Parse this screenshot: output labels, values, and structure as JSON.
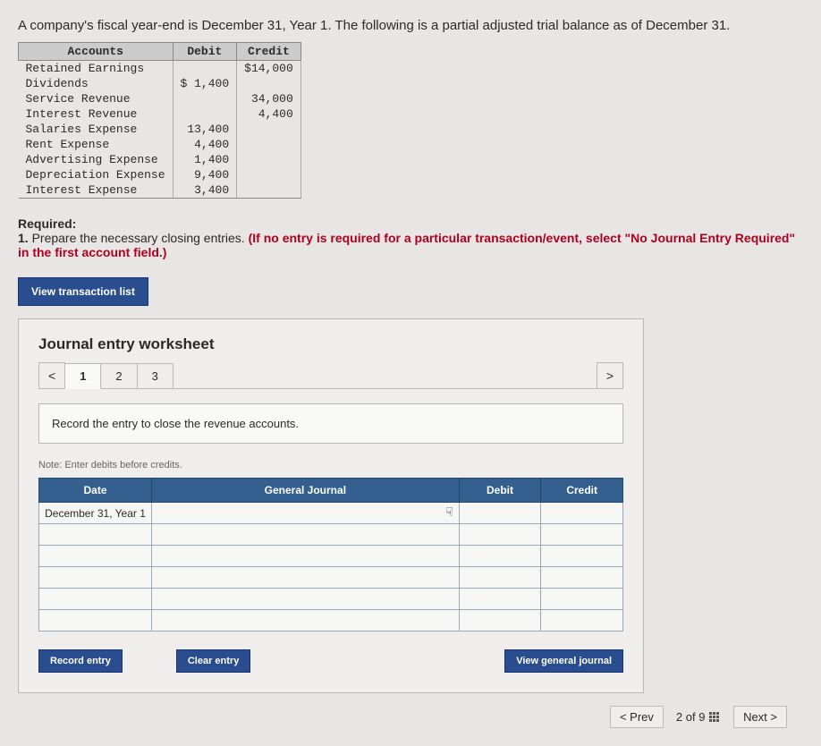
{
  "intro": "A company's fiscal year-end is December 31, Year 1. The following is a partial adjusted trial balance as of December 31.",
  "tb": {
    "headers": {
      "acct": "Accounts",
      "debit": "Debit",
      "credit": "Credit"
    },
    "rows": [
      {
        "acct": "Retained Earnings",
        "debit": "",
        "credit": "$14,000"
      },
      {
        "acct": "Dividends",
        "debit": "$ 1,400",
        "credit": ""
      },
      {
        "acct": "Service Revenue",
        "debit": "",
        "credit": "34,000"
      },
      {
        "acct": "Interest Revenue",
        "debit": "",
        "credit": "4,400"
      },
      {
        "acct": "Salaries Expense",
        "debit": "13,400",
        "credit": ""
      },
      {
        "acct": "Rent Expense",
        "debit": "4,400",
        "credit": ""
      },
      {
        "acct": "Advertising Expense",
        "debit": "1,400",
        "credit": ""
      },
      {
        "acct": "Depreciation Expense",
        "debit": "9,400",
        "credit": ""
      },
      {
        "acct": "Interest Expense",
        "debit": "3,400",
        "credit": ""
      }
    ]
  },
  "required": {
    "heading": "Required:",
    "item_num": "1.",
    "item_text_plain": " Prepare the necessary closing entries. ",
    "item_text_red": "(If no entry is required for a particular transaction/event, select \"No Journal Entry Required\" in the first account field.)"
  },
  "view_transaction_btn": "View transaction list",
  "worksheet": {
    "title": "Journal entry worksheet",
    "nav_prev": "<",
    "nav_next": ">",
    "tabs": [
      "1",
      "2",
      "3"
    ],
    "instruction": "Record the entry to close the revenue accounts.",
    "note": "Note: Enter debits before credits.",
    "headers": {
      "date": "Date",
      "gj": "General Journal",
      "debit": "Debit",
      "credit": "Credit"
    },
    "date_value": "December 31, Year 1",
    "buttons": {
      "record": "Record entry",
      "clear": "Clear entry",
      "viewgj": "View general journal"
    }
  },
  "pager": {
    "prev": "< Prev",
    "pos": "2 of 9",
    "next": "Next >"
  }
}
